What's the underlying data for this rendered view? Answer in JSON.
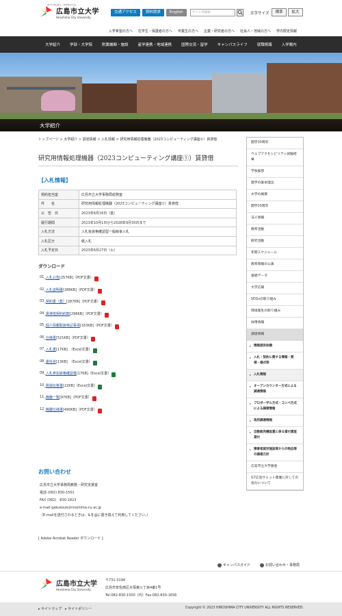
{
  "header": {
    "tagline": "まつりのひかり　ねぎをけつる",
    "logo_jp": "広島市立大学",
    "logo_en": "Hiroshima City University",
    "buttons": [
      "交通アクセス",
      "資料請求",
      "English"
    ],
    "search_placeholder": "サイト内検索",
    "font_size_label": "文字サイズ",
    "font_standard": "標準",
    "font_large": "拡大"
  },
  "subnav": [
    "入学希望の方へ",
    "在学生・保護者の方へ",
    "卒業生の方へ",
    "企業・研究者の方へ",
    "社会人・地域の方へ",
    "学内限定情報"
  ],
  "gnav": [
    "大学紹介",
    "学部・大学院",
    "附属機関・施設",
    "産学連携・地域連携",
    "国際交流・留学",
    "キャンパスライフ",
    "就職情報",
    "入学案内"
  ],
  "hero": {
    "caption": "大学紹介"
  },
  "breadcrumb": "トップページ > 大学紹介 > 調達情報 > 入札情報 > 研究用情報処理機器（2023コンピューティング講座①）賃貸借",
  "page_title": "研究用情報処理機器（2023コンピューティング講座①）賃貸借",
  "bid_info": {
    "heading": "【入札情報】",
    "rows": [
      {
        "k": "契約担当室",
        "v": "広島市立大学事務局総務室"
      },
      {
        "k": "件　　名",
        "v": "研究用情報処理機器（2023コンピューティング講座①）賃貸借"
      },
      {
        "k": "公　告　日",
        "v": "2023年6月16日（金）"
      },
      {
        "k": "履行期間",
        "v": "2023年10月1日から2028年9月30日まで"
      },
      {
        "k": "入札方法",
        "v": "入札後資格確認型一般競争入札"
      },
      {
        "k": "入札区分",
        "v": "紙入札"
      },
      {
        "k": "入札予定日",
        "v": "2023年6月27日（火）"
      }
    ]
  },
  "downloads": {
    "heading": "ダウンロード",
    "items": [
      {
        "no": "01_",
        "name": "入札公告",
        "meta": "[257KB]（PDF文書）",
        "type": "pdf"
      },
      {
        "no": "02_",
        "name": "入札説明書",
        "meta": "[286KB]（PDF文書）",
        "type": "pdf"
      },
      {
        "no": "03_",
        "name": "契約書（案）",
        "meta": "[287KB]（PDF文書）",
        "type": "pdf"
      },
      {
        "no": "04_",
        "name": "賃貸借契約約款",
        "meta": "[296KB]（PDF文書）",
        "type": "pdf"
      },
      {
        "no": "05_",
        "name": "個人情報取扱特記事項",
        "meta": "[163KB]（PDF文書）",
        "type": "pdf"
      },
      {
        "no": "06_",
        "name": "仕様書",
        "meta": "[521KB]（PDF文書）",
        "type": "pdf"
      },
      {
        "no": "07_",
        "name": "入札書",
        "meta": "[17KB]　（Excel文書）",
        "type": "xls"
      },
      {
        "no": "08_",
        "name": "委任状",
        "meta": "[13KB]　（Excel文書）",
        "type": "xls"
      },
      {
        "no": "09_",
        "name": "入札参加資格確認書",
        "meta": "[17KB]（Excel文書）",
        "type": "xls"
      },
      {
        "no": "10_",
        "name": "質疑応答書",
        "meta": "[22KB]（Excel文書）",
        "type": "xls"
      },
      {
        "no": "11_",
        "name": "機器一覧",
        "meta": "[97KB]（PDF文書）",
        "type": "pdf"
      },
      {
        "no": "12_",
        "name": "機器仕様書",
        "meta": "[490KB]（PDF文書）",
        "type": "pdf"
      }
    ]
  },
  "contact": {
    "heading": "お問い合わせ",
    "lines": [
      "広島市立大学事務局教務・研究支援室",
      "電話 (082) 830-1501",
      "FAX (082)　830-1823",
      "e-mail gakukoukuhiroshima-cu.ac.jp",
      "（E-mailを送付されるときは、&を@に置き換えて利用してください。）"
    ]
  },
  "acrobat": "[ Adobe Acrobat Reader ダウンロード ]",
  "sidebar": [
    {
      "label": "開学30周年",
      "style": ""
    },
    {
      "label": "ウェブアクセシビリティ試験結果",
      "style": ""
    },
    {
      "label": "学長挨拶",
      "style": ""
    },
    {
      "label": "建学の基本理念",
      "style": ""
    },
    {
      "label": "大学の概要",
      "style": ""
    },
    {
      "label": "開学20周年",
      "style": ""
    },
    {
      "label": "法人情報",
      "style": ""
    },
    {
      "label": "教育活動",
      "style": ""
    },
    {
      "label": "研究活動",
      "style": ""
    },
    {
      "label": "年間スケジュール",
      "style": ""
    },
    {
      "label": "教育情報の公表",
      "style": ""
    },
    {
      "label": "基礎データ",
      "style": ""
    },
    {
      "label": "大学広報",
      "style": ""
    },
    {
      "label": "SDGsの取り組み",
      "style": ""
    },
    {
      "label": "環境衛生の取り組み",
      "style": ""
    },
    {
      "label": "採用情報",
      "style": ""
    },
    {
      "label": "調達情報",
      "style": "active"
    },
    {
      "label": "情報提供依頼",
      "style": "sub"
    },
    {
      "label": "入札・契約に関する情報・要領・様式等",
      "style": "sub"
    },
    {
      "label": "入札情報",
      "style": "sub gray"
    },
    {
      "label": "オープンカウンター方式による調達情報",
      "style": "sub"
    },
    {
      "label": "プロポーザル方式・コンペ方式による調達情報",
      "style": "sub"
    },
    {
      "label": "政府調達情報",
      "style": "sub"
    },
    {
      "label": "自動販売機設置に係る貸付資産貸付",
      "style": "sub"
    },
    {
      "label": "障害者就労施設等からの物品等の調達方針",
      "style": "sub"
    },
    {
      "label": "広島市立大学基金",
      "style": ""
    },
    {
      "label": "G7広島サミット開催に対しての協力について",
      "style": ""
    }
  ],
  "footer": {
    "links": [
      "キャンパスガイド",
      "お問い合わせ・事務局"
    ],
    "logo_jp": "広島市立大学",
    "logo_en": "Hiroshima City University",
    "address": [
      "〒731-3194",
      "広島市安佐南区大塚東三丁目4番1号",
      "Tel:082-830-1500（代）Fax:082-830-1656"
    ],
    "bottom_left": "▸ サイトマップ　▸ サイトポリシー",
    "copyright": "Copyright © 2023 HIROSHIMA CITY UNIVERSITY ALL RIGHTS RESERVED."
  }
}
